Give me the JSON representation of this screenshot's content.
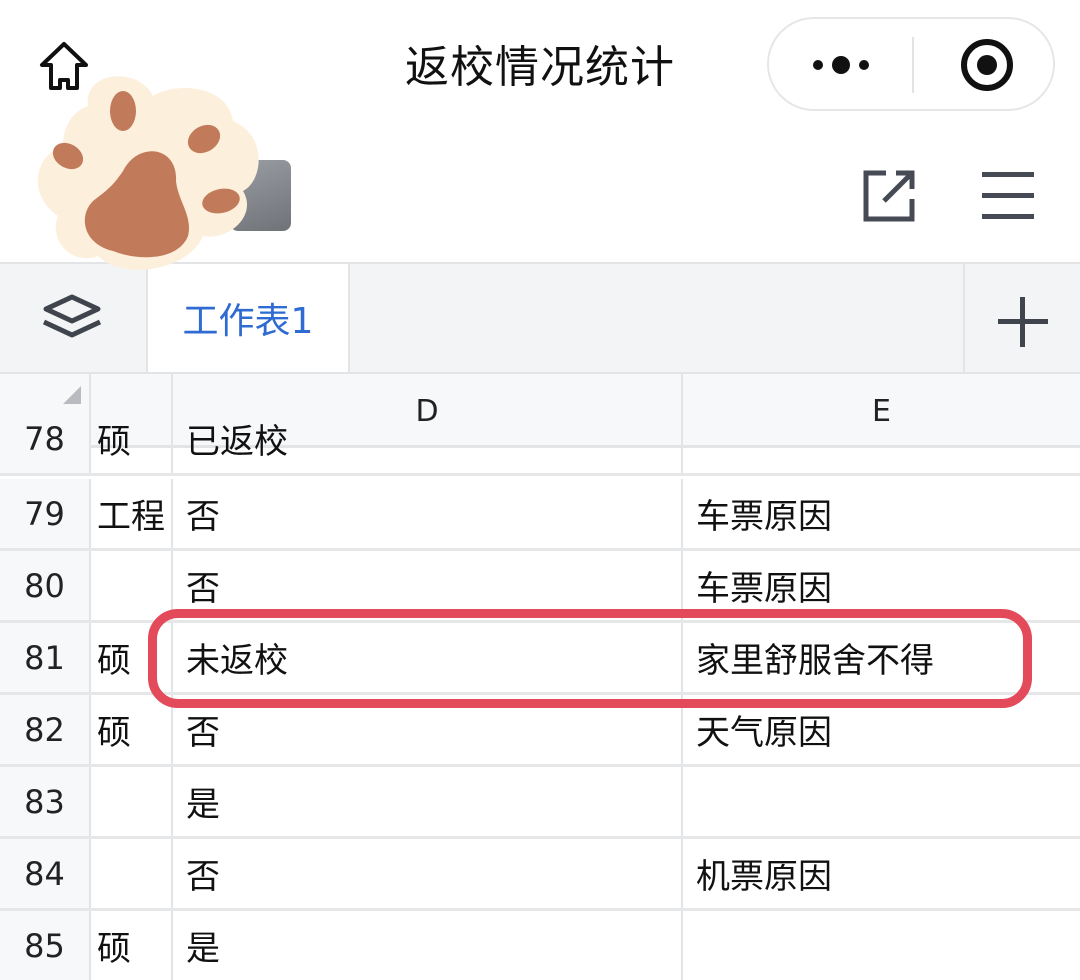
{
  "titlebar": {
    "title": "返校情况统计",
    "home_icon": "home-icon",
    "more_icon": "more-dots-icon",
    "target_icon": "record-target-icon"
  },
  "toolbar": {
    "share_icon": "open-external-icon",
    "menu_icon": "hamburger-menu-icon"
  },
  "tabbar": {
    "layers_icon": "layers-icon",
    "active_sheet": "工作表1",
    "add_icon": "plus-icon"
  },
  "grid": {
    "columns": [
      "",
      "D",
      "E"
    ],
    "rows": [
      {
        "num": "78",
        "c": "硕",
        "d": "已返校",
        "e": ""
      },
      {
        "num": "79",
        "c": "工程",
        "d": "否",
        "e": "车票原因"
      },
      {
        "num": "80",
        "c": "",
        "d": "否",
        "e": "车票原因"
      },
      {
        "num": "81",
        "c": "硕",
        "d": "未返校",
        "e": "家里舒服舍不得"
      },
      {
        "num": "82",
        "c": "硕",
        "d": "否",
        "e": "天气原因"
      },
      {
        "num": "83",
        "c": "",
        "d": "是",
        "e": ""
      },
      {
        "num": "84",
        "c": "",
        "d": "否",
        "e": "机票原因"
      },
      {
        "num": "85",
        "c": "硕",
        "d": "是",
        "e": ""
      }
    ],
    "highlighted_row": "81"
  },
  "colors": {
    "accent_tab": "#2f6bd1",
    "highlight": "#e34a5a",
    "paw_pad": "#c27b5a",
    "paw_fur": "#fcefdc"
  }
}
